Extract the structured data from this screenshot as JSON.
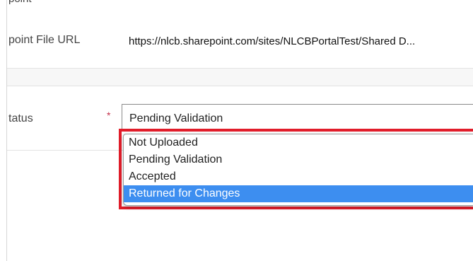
{
  "form": {
    "top_cut_label": "point",
    "sharepoint_url": {
      "label": "point File URL",
      "value": "https://nlcb.sharepoint.com/sites/NLCBPortalTest/Shared D..."
    },
    "status": {
      "label": "tatus",
      "required_mark": "*",
      "selected_value": "Pending Validation",
      "options": [
        {
          "label": "Not Uploaded"
        },
        {
          "label": "Pending Validation"
        },
        {
          "label": "Accepted"
        },
        {
          "label": "Returned for Changes",
          "highlighted": true
        }
      ]
    }
  },
  "colors": {
    "highlight_option": "#3d8ef0",
    "annotation_border": "#e11d2a",
    "required": "#c4314b"
  }
}
